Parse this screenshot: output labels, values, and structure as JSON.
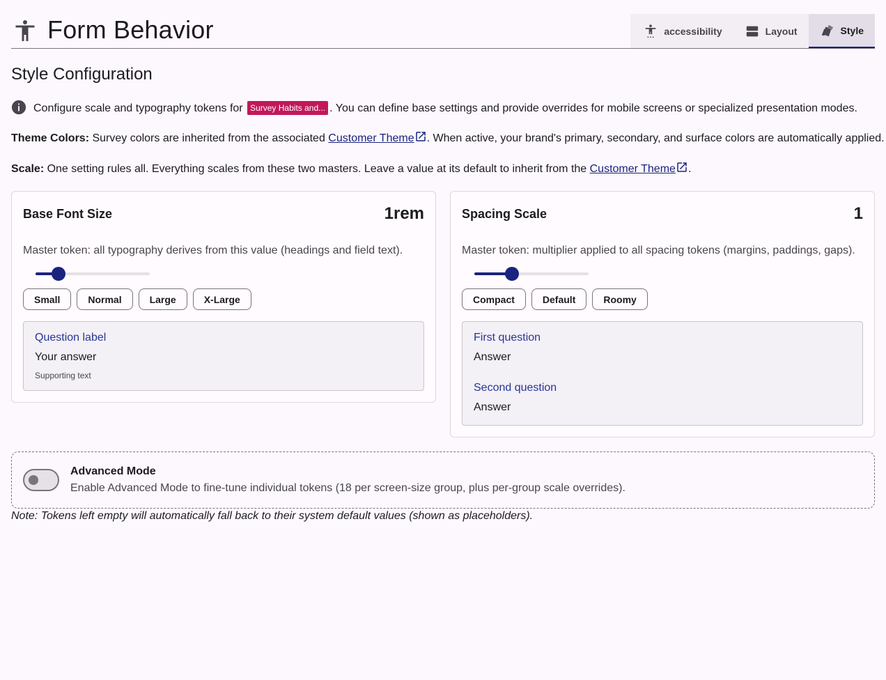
{
  "header": {
    "title": "Form Behavior",
    "tabs": [
      {
        "label": "accessibility",
        "icon": "accessibility-icon"
      },
      {
        "label": "Layout",
        "icon": "layout-icon"
      },
      {
        "label": "Style",
        "icon": "style-icon",
        "active": true
      }
    ]
  },
  "section_title": "Style Configuration",
  "intro": {
    "before": "Configure scale and typography tokens for",
    "chip": "Survey Habits and...",
    "after": ". You can define base settings and provide overrides for mobile screens or specialized presentation modes."
  },
  "theme": {
    "label": "Theme Colors:",
    "before": " Survey colors are inherited from the associated ",
    "link": "Customer Theme",
    "after": ". When active, your brand's primary, secondary, and surface colors are automatically applied."
  },
  "scale": {
    "label": "Scale:",
    "before": " One setting rules all. Everything scales from these two masters. Leave a value at its default to inherit from the ",
    "link": "Customer Theme",
    "after": "."
  },
  "font_card": {
    "title": "Base Font Size",
    "value": "1rem",
    "description": "Master token: all typography derives from this value (headings and field text).",
    "slider_fraction": 0.2,
    "buttons": [
      "Small",
      "Normal",
      "Large",
      "X-Large"
    ],
    "preview": {
      "question": "Question label",
      "answer": "Your answer",
      "supporting": "Supporting text"
    }
  },
  "spacing_card": {
    "title": "Spacing Scale",
    "value": "1",
    "description": "Master token: multiplier applied to all spacing tokens (margins, paddings, gaps).",
    "slider_fraction": 0.33,
    "buttons": [
      "Compact",
      "Default",
      "Roomy"
    ],
    "preview": {
      "q1": "First question",
      "a1": "Answer",
      "q2": "Second question",
      "a2": "Answer"
    }
  },
  "advanced": {
    "title": "Advanced Mode",
    "description": "Enable Advanced Mode to fine-tune individual tokens (18 per screen-size group, plus per-group scale overrides).",
    "enabled": false
  },
  "note": "Note: Tokens left empty will automatically fall back to their system default values (shown as placeholders).",
  "colors": {
    "primary": "#1a237e",
    "chip": "#c2185b",
    "background": "#fdf8fd"
  }
}
